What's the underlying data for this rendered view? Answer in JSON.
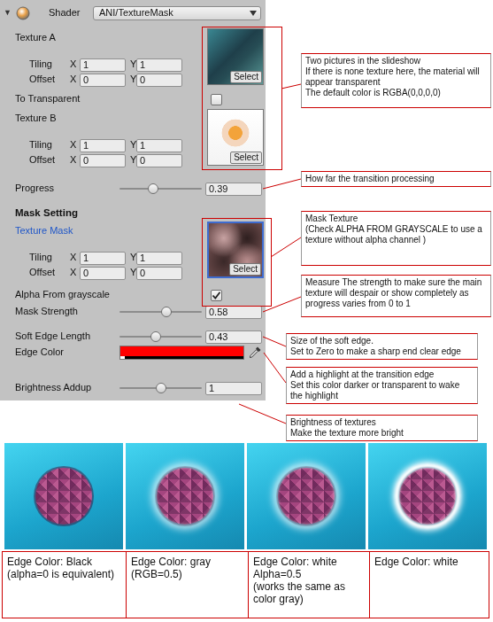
{
  "inspector": {
    "foldout": "▼",
    "shader_label": "Shader",
    "shader_value": "ANI/TextureMask",
    "properties": [
      {
        "kind": "texture",
        "label": "Texture A",
        "selected": false,
        "select_button": "Select",
        "tiling": {
          "label": "Tiling",
          "x_label": "X",
          "x": "1",
          "y_label": "Y",
          "y": "1"
        },
        "offset": {
          "label": "Offset",
          "x_label": "X",
          "x": "0",
          "y_label": "Y",
          "y": "0"
        }
      },
      {
        "kind": "toggle",
        "label": "To Transparent",
        "checked": false
      },
      {
        "kind": "texture",
        "label": "Texture B",
        "selected": false,
        "select_button": "Select",
        "tiling": {
          "label": "Tiling",
          "x_label": "X",
          "x": "1",
          "y_label": "Y",
          "y": "1"
        },
        "offset": {
          "label": "Offset",
          "x_label": "X",
          "x": "0",
          "y_label": "Y",
          "y": "0"
        }
      },
      {
        "kind": "slider",
        "label": "Progress",
        "level": 0.39,
        "reading": "0.39"
      },
      {
        "kind": "header",
        "label": "Mask Setting"
      },
      {
        "kind": "texture",
        "label": "Texture Mask",
        "selected": true,
        "select_button": "Select",
        "tiling": {
          "label": "Tiling",
          "x_label": "X",
          "x": "1",
          "y_label": "Y",
          "y": "1"
        },
        "offset": {
          "label": "Offset",
          "x_label": "X",
          "x": "0",
          "y_label": "Y",
          "y": "0"
        }
      },
      {
        "kind": "toggle",
        "label": "Alpha From grayscale",
        "checked": true
      },
      {
        "kind": "slider",
        "label": "Mask Strength",
        "level": 0.58,
        "reading": "0.58"
      },
      {
        "kind": "slider",
        "label": "Soft Edge Length",
        "level": 0.43,
        "reading": "0.43"
      },
      {
        "kind": "color",
        "label": "Edge Color",
        "color": "#ff0000"
      },
      {
        "kind": "slider",
        "label": "Brightness Addup",
        "level": 0.5,
        "reading": "1"
      }
    ]
  },
  "callouts": [
    {
      "lines": [
        "Two pictures in the slideshow",
        "If there is none texture here, the material will appear transparent",
        "The default color is RGBA(0,0,0,0)"
      ]
    },
    {
      "lines": [
        "How far the transition processing"
      ]
    },
    {
      "lines": [
        "Mask Texture",
        " (Check ALPHA FROM GRAYSCALE to use a texture without alpha channel )"
      ]
    },
    {
      "lines": [
        "Measure The strength to make sure the main texture will despair or show completely as progress varies from 0 to 1"
      ]
    },
    {
      "lines": [
        "Size of the soft edge.",
        "Set to Zero to make a sharp end clear edge"
      ]
    },
    {
      "lines": [
        "Add a highlight at the transition edge",
        "Set this color darker or transparent to wake the highlight"
      ]
    },
    {
      "lines": [
        "Brightness of textures",
        "Make the texture more bright"
      ]
    }
  ],
  "examples": [
    {
      "color": "#000000",
      "caption": [
        "Edge Color: Black",
        "(alpha=0 is equivalent)"
      ]
    },
    {
      "color": "#808080",
      "caption": [
        "Edge Color: gray",
        "(RGB=0.5)"
      ]
    },
    {
      "color": "#ffffff80",
      "caption": [
        "Edge Color: white",
        "Alpha=0.5",
        "(works the same as color gray)"
      ]
    },
    {
      "color": "#ffffff",
      "caption": [
        "Edge Color: white"
      ]
    }
  ]
}
